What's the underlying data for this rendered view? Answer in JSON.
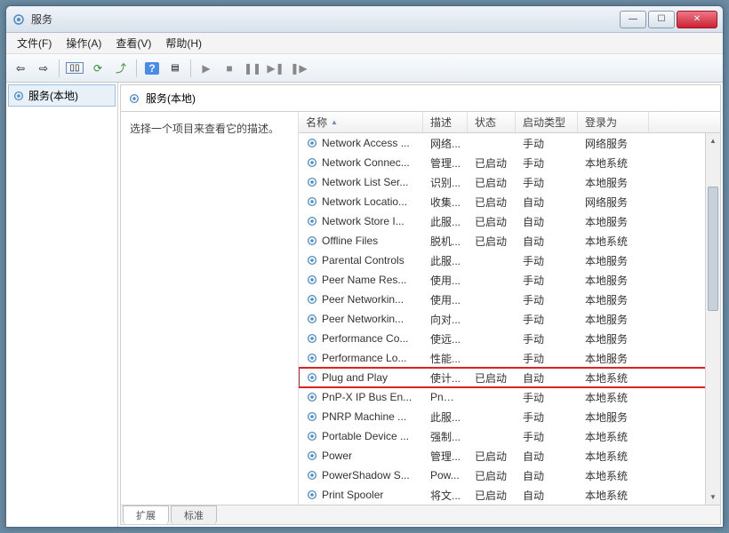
{
  "window": {
    "title": "服务"
  },
  "menu": {
    "file": "文件(F)",
    "action": "操作(A)",
    "view": "查看(V)",
    "help": "帮助(H)"
  },
  "tree": {
    "root": "服务(本地)"
  },
  "panel": {
    "heading": "服务(本地)",
    "desc_prompt": "选择一个项目来查看它的描述。"
  },
  "columns": {
    "name": "名称",
    "desc": "描述",
    "status": "状态",
    "startup": "启动类型",
    "logon": "登录为"
  },
  "tabs": {
    "extended": "扩展",
    "standard": "标准"
  },
  "toolbar_icons": [
    "back",
    "forward",
    "up",
    "properties",
    "refresh",
    "export",
    "help",
    "show-hide",
    "start",
    "pause",
    "stop",
    "step",
    "restart"
  ],
  "highlight_row": "Plug and Play",
  "services": [
    {
      "name": "Network Access ...",
      "desc": "网络...",
      "status": "",
      "startup": "手动",
      "logon": "网络服务"
    },
    {
      "name": "Network Connec...",
      "desc": "管理...",
      "status": "已启动",
      "startup": "手动",
      "logon": "本地系统"
    },
    {
      "name": "Network List Ser...",
      "desc": "识别...",
      "status": "已启动",
      "startup": "手动",
      "logon": "本地服务"
    },
    {
      "name": "Network Locatio...",
      "desc": "收集...",
      "status": "已启动",
      "startup": "自动",
      "logon": "网络服务"
    },
    {
      "name": "Network Store I...",
      "desc": "此服...",
      "status": "已启动",
      "startup": "自动",
      "logon": "本地服务"
    },
    {
      "name": "Offline Files",
      "desc": "脱机...",
      "status": "已启动",
      "startup": "自动",
      "logon": "本地系统"
    },
    {
      "name": "Parental Controls",
      "desc": "此服...",
      "status": "",
      "startup": "手动",
      "logon": "本地服务"
    },
    {
      "name": "Peer Name Res...",
      "desc": "使用...",
      "status": "",
      "startup": "手动",
      "logon": "本地服务"
    },
    {
      "name": "Peer Networkin...",
      "desc": "使用...",
      "status": "",
      "startup": "手动",
      "logon": "本地服务"
    },
    {
      "name": "Peer Networkin...",
      "desc": "向对...",
      "status": "",
      "startup": "手动",
      "logon": "本地服务"
    },
    {
      "name": "Performance Co...",
      "desc": "使远...",
      "status": "",
      "startup": "手动",
      "logon": "本地服务"
    },
    {
      "name": "Performance Lo...",
      "desc": "性能...",
      "status": "",
      "startup": "手动",
      "logon": "本地服务"
    },
    {
      "name": "Plug and Play",
      "desc": "使计...",
      "status": "已启动",
      "startup": "自动",
      "logon": "本地系统"
    },
    {
      "name": "PnP-X IP Bus En...",
      "desc": "PnP-...",
      "status": "",
      "startup": "手动",
      "logon": "本地系统"
    },
    {
      "name": "PNRP Machine ...",
      "desc": "此服...",
      "status": "",
      "startup": "手动",
      "logon": "本地服务"
    },
    {
      "name": "Portable Device ...",
      "desc": "强制...",
      "status": "",
      "startup": "手动",
      "logon": "本地系统"
    },
    {
      "name": "Power",
      "desc": "管理...",
      "status": "已启动",
      "startup": "自动",
      "logon": "本地系统"
    },
    {
      "name": "PowerShadow S...",
      "desc": "Pow...",
      "status": "已启动",
      "startup": "自动",
      "logon": "本地系统"
    },
    {
      "name": "Print Spooler",
      "desc": "将文...",
      "status": "已启动",
      "startup": "自动",
      "logon": "本地系统"
    }
  ]
}
